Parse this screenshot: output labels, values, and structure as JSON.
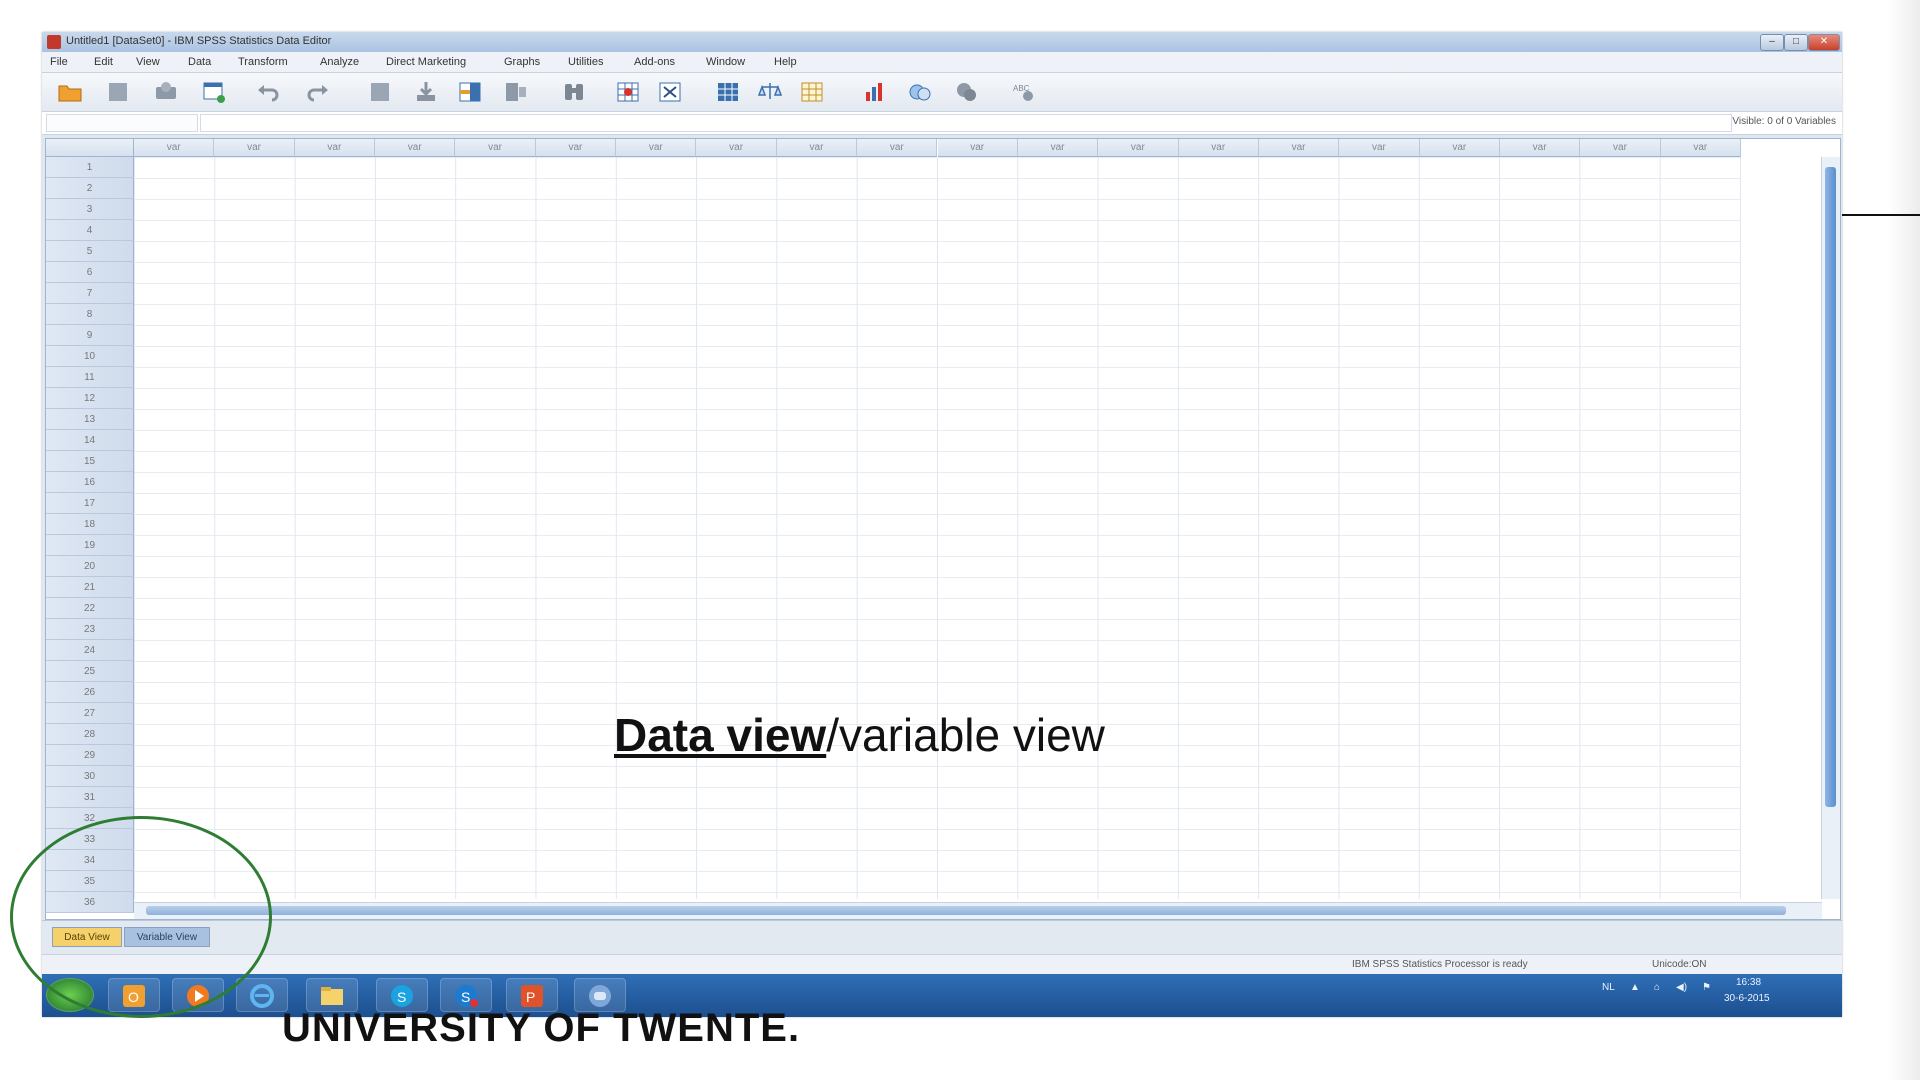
{
  "window": {
    "title": "Untitled1 [DataSet0] - IBM SPSS Statistics Data Editor",
    "controls": {
      "minimize": "–",
      "maximize": "□",
      "close": "✕"
    }
  },
  "menu": [
    "File",
    "Edit",
    "View",
    "Data",
    "Transform",
    "Analyze",
    "Direct Marketing",
    "Graphs",
    "Utilities",
    "Add-ons",
    "Window",
    "Help"
  ],
  "toolbar": {
    "icons": [
      "open-folder-icon",
      "save-icon",
      "print-icon",
      "dialog-recall-icon",
      "undo-icon",
      "redo-icon",
      "goto-case-icon",
      "goto-variable-icon",
      "variables-icon",
      "split-file-icon",
      "find-icon",
      "insert-cases-icon",
      "select-cases-icon",
      "value-labels-icon",
      "weight-cases-icon",
      "use-sets-icon",
      "show-all-variables-icon",
      "chart-icon",
      "spell-check-icon",
      "script-icon"
    ]
  },
  "cellbar": {
    "visible_text": "Visible: 0 of 0 Variables"
  },
  "grid": {
    "column_header": "var",
    "column_count": 20,
    "rows": [
      "1",
      "2",
      "3",
      "4",
      "5",
      "6",
      "7",
      "8",
      "9",
      "10",
      "11",
      "12",
      "13",
      "14",
      "15",
      "16",
      "17",
      "18",
      "19",
      "20",
      "21",
      "22",
      "23",
      "24",
      "25",
      "26",
      "27",
      "28",
      "29",
      "30",
      "31",
      "32",
      "33",
      "34",
      "35",
      "36"
    ]
  },
  "tabs": {
    "data_view": "Data View",
    "variable_view": "Variable View"
  },
  "status": {
    "processor": "IBM SPSS Statistics Processor is ready",
    "unicode": "Unicode:ON"
  },
  "taskbar": {
    "apps": [
      "start-orb-icon",
      "outlook-icon",
      "media-player-icon",
      "internet-explorer-icon",
      "file-explorer-icon",
      "skype-icon",
      "skype-business-icon",
      "powerpoint-icon",
      "spss-icon"
    ],
    "tray_lang": "NL",
    "time": "16:38",
    "date": "30-6-2015"
  },
  "overlay": {
    "strong": "Data view",
    "rest": "/variable view"
  },
  "footer": {
    "university": "UNIVERSITY OF TWENTE."
  },
  "colors": {
    "accent_circle": "#2e7d32",
    "active_tab": "#f4d16b",
    "taskbar": "#1c4f8f"
  }
}
